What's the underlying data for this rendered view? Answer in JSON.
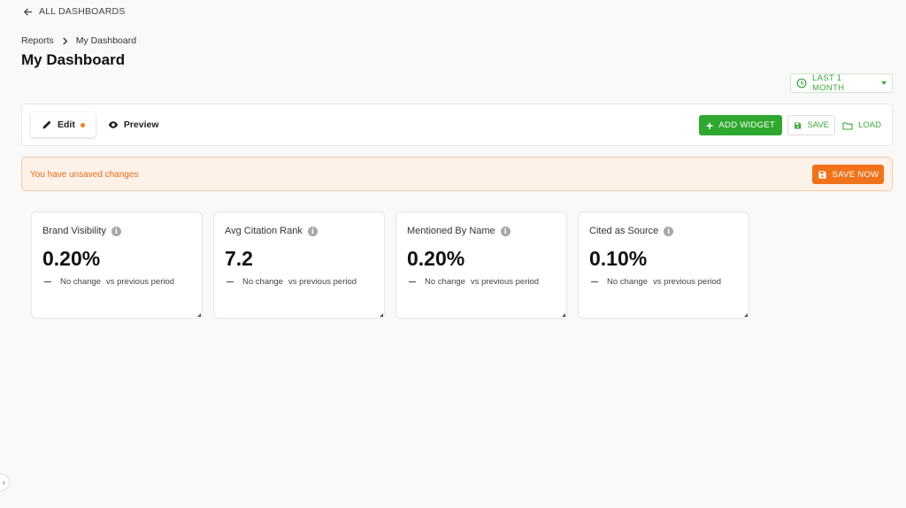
{
  "nav": {
    "back_label": "ALL DASHBOARDS"
  },
  "breadcrumb": {
    "items": [
      "Reports",
      "My Dashboard"
    ]
  },
  "page": {
    "title": "My Dashboard"
  },
  "date_range": {
    "label": "LAST 1 MONTH"
  },
  "toolbar": {
    "edit_label": "Edit",
    "preview_label": "Preview",
    "add_widget_label": "ADD WIDGET",
    "save_label": "SAVE",
    "load_label": "LOAD"
  },
  "alert": {
    "message": "You have unsaved changes",
    "save_now_label": "SAVE NOW"
  },
  "widgets": [
    {
      "title": "Brand Visibility",
      "value": "0.20%",
      "change": "No change",
      "comparison": "vs previous period"
    },
    {
      "title": "Avg Citation Rank",
      "value": "7.2",
      "change": "No change",
      "comparison": "vs previous period"
    },
    {
      "title": "Mentioned By Name",
      "value": "0.20%",
      "change": "No change",
      "comparison": "vs previous period"
    },
    {
      "title": "Cited as Source",
      "value": "0.10%",
      "change": "No change",
      "comparison": "vs previous period"
    }
  ],
  "colors": {
    "accent_green": "#2ea82e",
    "accent_orange": "#f0731c",
    "alert_bg": "#fdf1e8"
  }
}
